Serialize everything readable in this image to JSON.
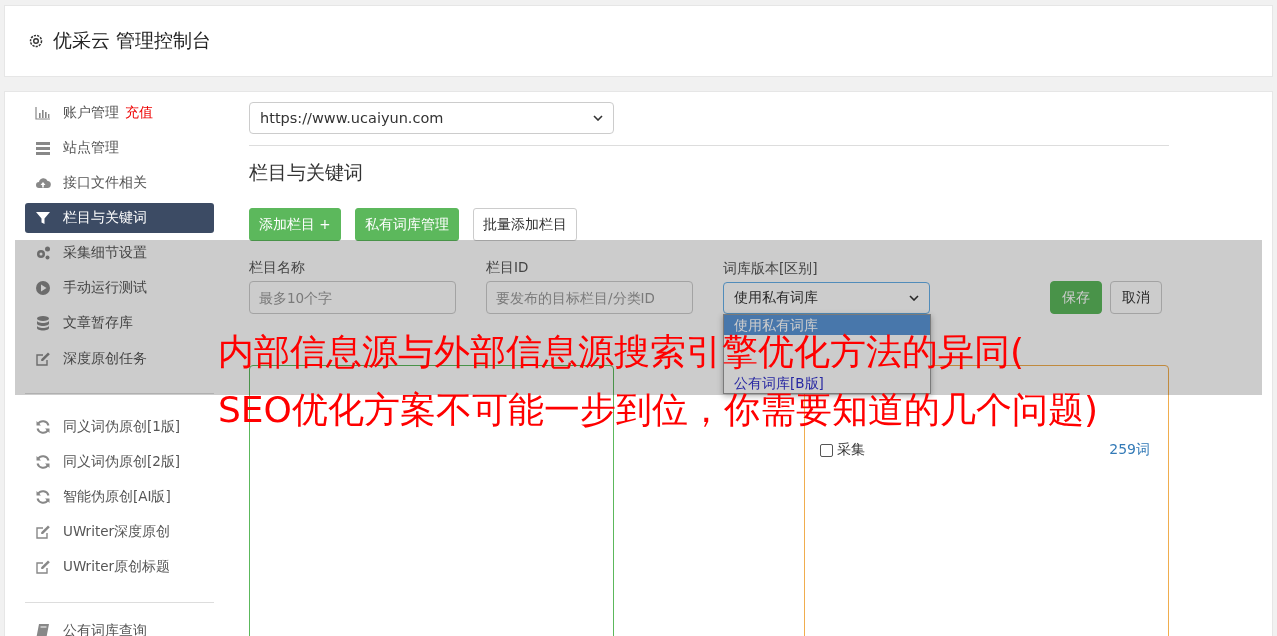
{
  "header": {
    "title": "优采云 管理控制台"
  },
  "sidebar": {
    "items": [
      {
        "label": "账户管理",
        "badge": "充值",
        "selected": false
      },
      {
        "label": "站点管理",
        "selected": false
      },
      {
        "label": "接口文件相关",
        "selected": false
      },
      {
        "label": "栏目与关键词",
        "selected": true
      },
      {
        "label": "采集细节设置",
        "selected": false
      },
      {
        "label": "手动运行测试",
        "selected": false
      },
      {
        "label": "文章暂存库",
        "selected": false
      },
      {
        "label": "深度原创任务",
        "selected": false
      }
    ],
    "items_2": [
      {
        "label": "同义词伪原创[1版]",
        "selected": false
      },
      {
        "label": "同义词伪原创[2版]",
        "selected": false
      },
      {
        "label": "智能伪原创[AI版]",
        "selected": false
      },
      {
        "label": "UWriter深度原创",
        "selected": false
      },
      {
        "label": "UWriter原创标题",
        "selected": false
      }
    ],
    "items_3": [
      {
        "label": "公有词库查询",
        "selected": false
      }
    ]
  },
  "site_select": {
    "value": "https://www.ucaiyun.com"
  },
  "section_title": "栏目与关键词",
  "buttons": [
    {
      "label": "添加栏目 +",
      "kind": "primary"
    },
    {
      "label": "私有词库管理",
      "kind": "primary"
    },
    {
      "label": "批量添加栏目",
      "kind": "default"
    }
  ],
  "form": {
    "fields": [
      {
        "label": "栏目名称",
        "placeholder": "最多10个字"
      },
      {
        "label": "栏目ID",
        "placeholder": "要发布的目标栏目/分类ID"
      }
    ],
    "version": {
      "label": "词库版本[区别]",
      "value": "使用私有词库",
      "options": [
        {
          "label": "使用私有词库",
          "selected": true
        },
        {
          "label": "公有词库[B版]",
          "selected": false
        }
      ]
    },
    "save": "保存",
    "cancel": "取消"
  },
  "libraries": [
    {
      "label": "采集",
      "count": "259词",
      "checked": false
    }
  ],
  "overlay_title": [
    "内部信息源与外部信息源搜索引擎优化方法的异同(",
    "SEO优化方案不可能一步到位，你需要知道的几个问题)"
  ]
}
